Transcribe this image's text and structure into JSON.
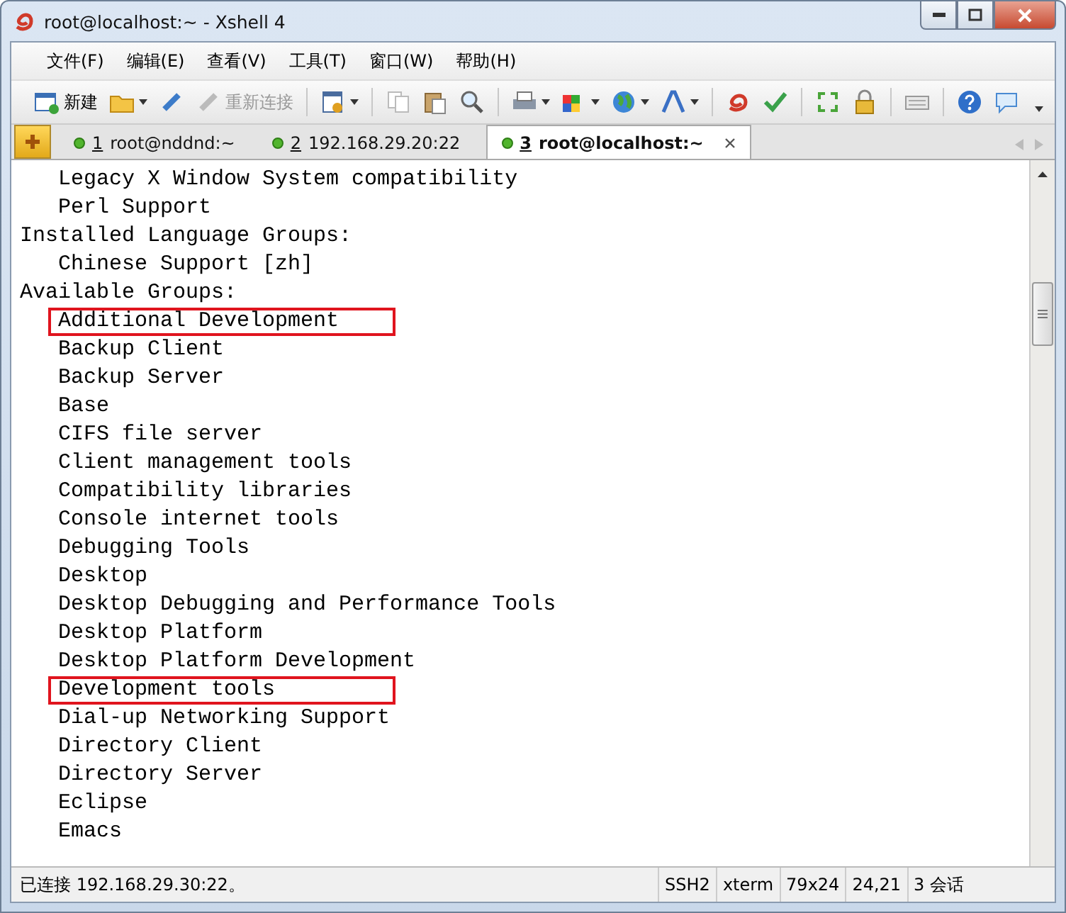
{
  "window": {
    "title": "root@localhost:~ - Xshell 4"
  },
  "menu": [
    "文件(F)",
    "编辑(E)",
    "查看(V)",
    "工具(T)",
    "窗口(W)",
    "帮助(H)"
  ],
  "toolbar": [
    {
      "kind": "labeled",
      "label": "新建",
      "disabled": false,
      "dropdown": false
    },
    {
      "kind": "icon",
      "dropdown": true
    },
    {
      "kind": "icon",
      "dropdown": false
    },
    {
      "kind": "labeled",
      "label": "重新连接",
      "disabled": true,
      "dropdown": false
    },
    {
      "kind": "separator"
    },
    {
      "kind": "icon",
      "dropdown": true
    },
    {
      "kind": "separator"
    },
    {
      "kind": "icon",
      "dropdown": false
    },
    {
      "kind": "icon",
      "dropdown": false
    },
    {
      "kind": "icon",
      "dropdown": false
    },
    {
      "kind": "separator"
    },
    {
      "kind": "icon",
      "dropdown": true
    },
    {
      "kind": "icon",
      "dropdown": true
    },
    {
      "kind": "icon",
      "dropdown": true
    },
    {
      "kind": "icon",
      "dropdown": true
    },
    {
      "kind": "separator"
    },
    {
      "kind": "icon",
      "dropdown": false
    },
    {
      "kind": "icon",
      "dropdown": false
    },
    {
      "kind": "separator"
    },
    {
      "kind": "icon",
      "dropdown": false
    },
    {
      "kind": "icon",
      "dropdown": false
    },
    {
      "kind": "separator"
    },
    {
      "kind": "icon",
      "dropdown": false
    },
    {
      "kind": "separator"
    },
    {
      "kind": "icon",
      "dropdown": false
    },
    {
      "kind": "icon",
      "dropdown": false
    }
  ],
  "tabs": [
    {
      "number": "1",
      "label": "root@nddnd:~",
      "selected": false
    },
    {
      "number": "2",
      "label": "192.168.29.20:22",
      "selected": false
    },
    {
      "number": "3",
      "label": "root@localhost:~",
      "selected": true
    }
  ],
  "terminal": [
    {
      "text": "   Legacy X Window System compatibility",
      "highlighted": false
    },
    {
      "text": "   Perl Support",
      "highlighted": false
    },
    {
      "text": "Installed Language Groups:",
      "highlighted": false
    },
    {
      "text": "   Chinese Support [zh]",
      "highlighted": false
    },
    {
      "text": "Available Groups:",
      "highlighted": false
    },
    {
      "text": "   Additional Development",
      "highlighted": true
    },
    {
      "text": "   Backup Client",
      "highlighted": false
    },
    {
      "text": "   Backup Server",
      "highlighted": false
    },
    {
      "text": "   Base",
      "highlighted": false
    },
    {
      "text": "   CIFS file server",
      "highlighted": false
    },
    {
      "text": "   Client management tools",
      "highlighted": false
    },
    {
      "text": "   Compatibility libraries",
      "highlighted": false
    },
    {
      "text": "   Console internet tools",
      "highlighted": false
    },
    {
      "text": "   Debugging Tools",
      "highlighted": false
    },
    {
      "text": "   Desktop",
      "highlighted": false
    },
    {
      "text": "   Desktop Debugging and Performance Tools",
      "highlighted": false
    },
    {
      "text": "   Desktop Platform",
      "highlighted": false
    },
    {
      "text": "   Desktop Platform Development",
      "highlighted": false
    },
    {
      "text": "   Development tools",
      "highlighted": true
    },
    {
      "text": "   Dial-up Networking Support",
      "highlighted": false
    },
    {
      "text": "   Directory Client",
      "highlighted": false
    },
    {
      "text": "   Directory Server",
      "highlighted": false
    },
    {
      "text": "   Eclipse",
      "highlighted": false
    },
    {
      "text": "   Emacs",
      "highlighted": false
    }
  ],
  "status_bar": {
    "message": "已连接 192.168.29.30:22。",
    "cells": [
      "SSH2",
      "xterm",
      "79x24",
      "24,21",
      "3 会话"
    ]
  }
}
